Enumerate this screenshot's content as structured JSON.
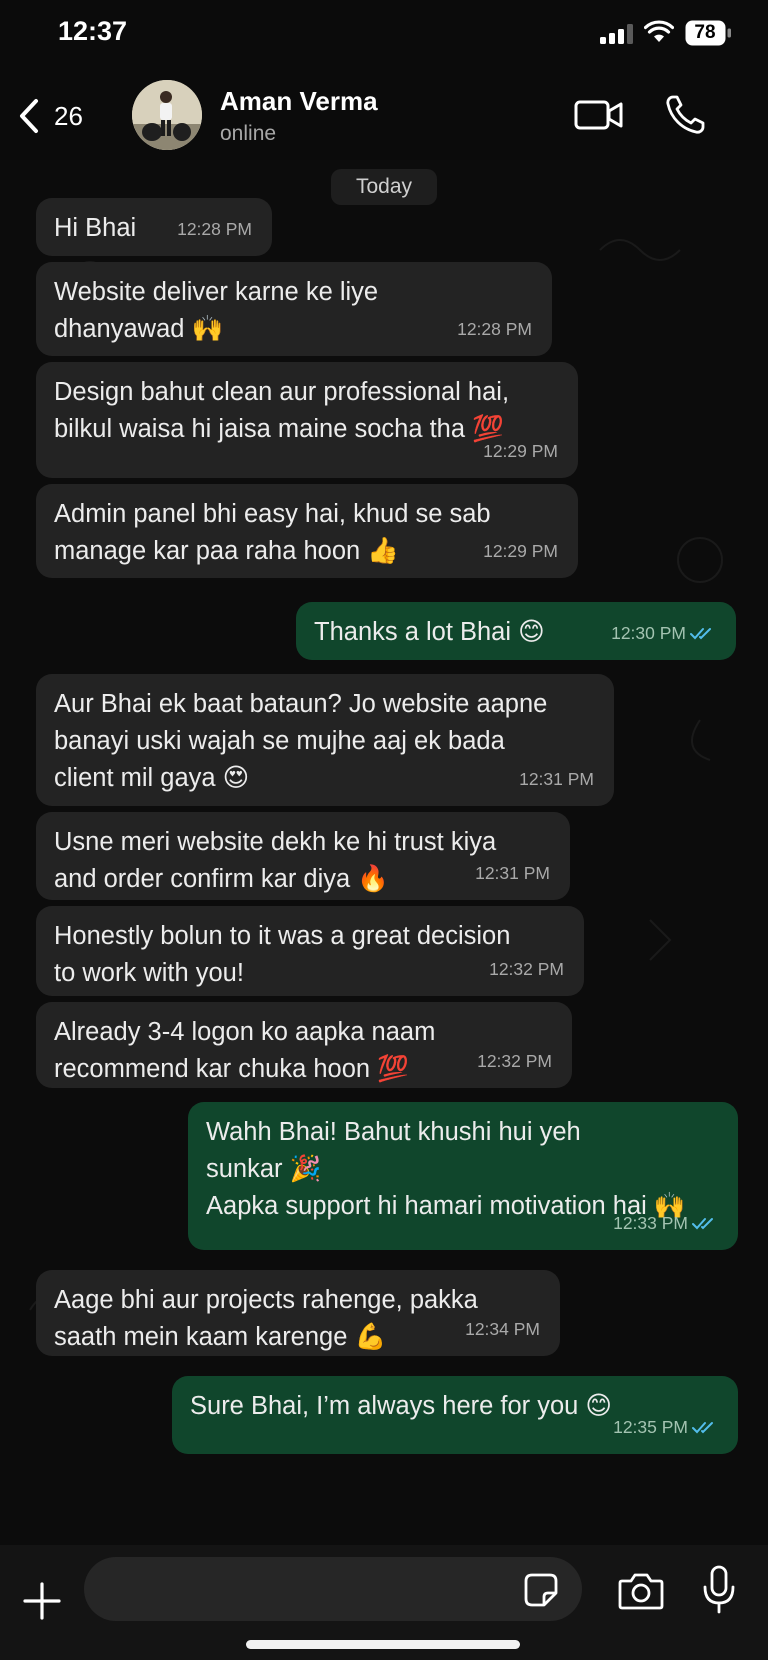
{
  "status_bar": {
    "time": "12:37",
    "battery": "78",
    "icons": [
      "signal-icon",
      "wifi-icon",
      "battery-icon"
    ]
  },
  "header": {
    "back_count": "26",
    "contact_name": "Aman Verma",
    "contact_status": "online",
    "icons": [
      "chevron-left-icon",
      "video-call-icon",
      "phone-icon"
    ]
  },
  "chat": {
    "day_label": "Today",
    "messages": [
      {
        "dir": "in",
        "lines": [
          "Hi Bhai"
        ],
        "time": "12:28 PM"
      },
      {
        "dir": "in",
        "lines": [
          "Website deliver karne ke liye",
          "dhanyawad 🙌"
        ],
        "time": "12:28 PM"
      },
      {
        "dir": "in",
        "lines": [
          "Design bahut clean aur professional hai,",
          "bilkul waisa hi jaisa maine socha tha 💯"
        ],
        "time": "12:29 PM"
      },
      {
        "dir": "in",
        "lines": [
          "Admin panel bhi easy hai, khud se sab",
          "manage kar paa raha hoon 👍"
        ],
        "time": "12:29 PM"
      },
      {
        "dir": "out",
        "lines": [
          "Thanks a lot Bhai 😊"
        ],
        "time": "12:30 PM",
        "status": "read"
      },
      {
        "dir": "in",
        "lines": [
          "Aur Bhai ek baat bataun? Jo website aapne",
          "banayi uski wajah se mujhe aaj ek bada",
          "client mil gaya 😍"
        ],
        "time": "12:31 PM"
      },
      {
        "dir": "in",
        "lines": [
          "Usne meri website dekh ke hi trust kiya",
          "and order confirm kar diya 🔥"
        ],
        "time": "12:31 PM"
      },
      {
        "dir": "in",
        "lines": [
          "Honestly bolun to it was a great decision",
          "to work with you!"
        ],
        "time": "12:32 PM"
      },
      {
        "dir": "in",
        "lines": [
          "Already 3-4 logon ko aapka naam",
          "recommend kar chuka hoon 💯"
        ],
        "time": "12:32 PM"
      },
      {
        "dir": "out",
        "lines": [
          "Wahh Bhai! Bahut khushi hui yeh",
          "sunkar 🎉",
          "Aapka support hi hamari motivation hai 🙌"
        ],
        "time": "12:33 PM",
        "status": "read"
      },
      {
        "dir": "in",
        "lines": [
          "Aage bhi aur projects rahenge, pakka",
          "saath mein kaam karenge 💪"
        ],
        "time": "12:34 PM"
      },
      {
        "dir": "out",
        "lines": [
          "Sure Bhai, I’m always here for you 😊"
        ],
        "time": "12:35 PM",
        "status": "read"
      }
    ]
  },
  "input_bar": {
    "placeholder": "",
    "icons": [
      "plus-icon",
      "sticker-icon",
      "camera-icon",
      "microphone-icon"
    ]
  },
  "colors": {
    "incoming_bubble": "#232323",
    "outgoing_bubble": "#10462c",
    "read_ticks": "#53bdeb",
    "background": "#0b0b0b"
  }
}
